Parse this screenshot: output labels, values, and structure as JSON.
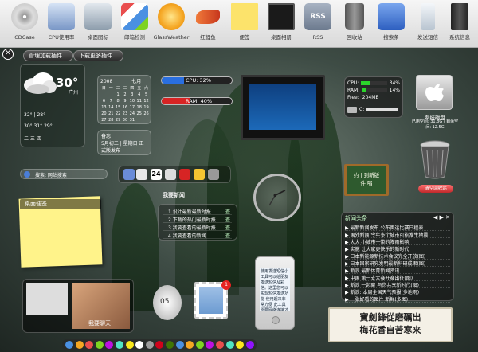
{
  "topbar": {
    "items": [
      {
        "label": "CDCase",
        "icon": "cd-icon",
        "color": "#c9c9c9"
      },
      {
        "label": "CPU使用率",
        "icon": "cpu-icon",
        "color": "#6a8cc8"
      },
      {
        "label": "桌面图标",
        "icon": "desktop-icons-icon",
        "color": "#9aa9b8"
      },
      {
        "label": "邮箱检测",
        "icon": "mail-check-icon",
        "color": "#e8e8e8"
      },
      {
        "label": "GlassWeather",
        "icon": "sun-icon",
        "color": "#f5a623"
      },
      {
        "label": "红鲤鱼",
        "icon": "fish-icon",
        "color": "#d84a2a"
      },
      {
        "label": "便签",
        "icon": "sticky-note-icon",
        "color": "#fce36b"
      },
      {
        "label": "桌面相册",
        "icon": "photo-album-icon",
        "color": "#222222"
      },
      {
        "label": "RSS",
        "icon": "rss-icon",
        "color": "#8a96a8"
      },
      {
        "label": "回收站",
        "icon": "recycle-bin-icon",
        "color": "#707070"
      },
      {
        "label": "搜索条",
        "icon": "search-bar-icon",
        "color": "#4a7ed8"
      },
      {
        "label": "发送短信",
        "icon": "sms-phone-icon",
        "color": "#dde4ec"
      },
      {
        "label": "系统信息",
        "icon": "system-info-icon",
        "color": "#3a3a3a"
      }
    ]
  },
  "toolbar": {
    "close": "✕",
    "manage_label": "管理加载插件...",
    "download_label": "下载更多插件..."
  },
  "weather": {
    "temp": "30°",
    "city": "广州",
    "rows": [
      "32° | 28°",
      "30° 31° 29°",
      "二 三 四"
    ]
  },
  "calendar": {
    "year": "2008",
    "month": "七月",
    "days": [
      "日",
      "一",
      "二",
      "三",
      "四",
      "五",
      "六",
      "",
      "",
      "1",
      "2",
      "3",
      "4",
      "5",
      "6",
      "7",
      "8",
      "9",
      "10",
      "11",
      "12",
      "13",
      "14",
      "15",
      "16",
      "17",
      "18",
      "19",
      "20",
      "21",
      "22",
      "23",
      "24",
      "25",
      "26",
      "27",
      "28",
      "29",
      "30",
      "31",
      "",
      ""
    ],
    "memo_title": "备忘：",
    "memo_text": "5月初二 | 星期日 正式版发布"
  },
  "gauges": {
    "cpu": {
      "text": "CPU: 32%",
      "value": 0.32,
      "color": "#2a6fe0"
    },
    "ram": {
      "text": "RAM: 40%",
      "value": 0.4,
      "color": "#d72424"
    }
  },
  "sysmon": {
    "cpu": "CPU:",
    "cpu_val": "34%",
    "cpu_level": 0.34,
    "ram": "RAM:",
    "ram_val": "14%",
    "ram_level": 0.14,
    "free": "Free:",
    "free_val": "204MB",
    "drive": "C:"
  },
  "sysdisk": {
    "title": "系统磁盘",
    "info": "已用空间: 31.8G / 剩余空间: 12.5G"
  },
  "recycle": {
    "label": "清空回收站"
  },
  "search": {
    "placeholder": "搜索: 网站搜索"
  },
  "favorites": {
    "label": "我要新闻"
  },
  "board": {
    "lines": [
      "约 | 到新版",
      "件 唱"
    ]
  },
  "note": {
    "title": "桌面便签"
  },
  "recent": {
    "items": [
      {
        "title": "1.设计最新最新时报",
        "tag": "查"
      },
      {
        "title": "2.下载的热门最新时报",
        "tag": "查"
      },
      {
        "title": "3.我要查看的最新时报",
        "tag": "查"
      },
      {
        "title": "4.我要查看的新闻",
        "tag": "查"
      }
    ]
  },
  "news": {
    "title": "新闻头条",
    "controls": "◀ ▶ ✕",
    "items": [
      "▶ 最新新闻发布 公布奥运比赛日程表",
      "▶ 国外新闻 今年多个城市可能发生地震",
      "▶ 大大 小城市一带的降雨影响",
      "▶ 实施 让大家更快乐的新时代",
      "▶ 日本新能源新技术会议完全开放(图)",
      "▶ 日本国家研究发明最新科研成果(图)",
      "▶ 新浪 最新体育新闻资讯",
      "▶ 中国 第一支大赛开赛出征(图)",
      "▶ 新浪 一起聊 与您共享新时代(图)",
      "▶ 新浪: 本周全国天气预报(多地雨)",
      "▶ 一张好看的图片 新鲜(多图)"
    ]
  },
  "calligraphy": {
    "line1": "寶劍鋒從磨礪出",
    "line2": "梅花香自苦寒来"
  },
  "phone": {
    "text": "使用发送短信小工具可以给朋友发送短信及彩信。这里您可以实现短信发送功能 使用起来非常方便 此工具需要网络连接才能使用"
  },
  "egg": {
    "value": "05"
  },
  "stamp": {
    "badge": "1"
  },
  "bottom_widget": {
    "title": "我要聊天"
  },
  "dock": {
    "colors": [
      "#4a90e2",
      "#f5a623",
      "#e94e4e",
      "#7ed321",
      "#bd10e0",
      "#50e3c2",
      "#f8e71c",
      "#ffffff",
      "#9b9b9b",
      "#d0021b",
      "#417505",
      "#4a90e2",
      "#f5a623",
      "#7ed321",
      "#bd10e0",
      "#e94e4e",
      "#50e3c2",
      "#f8e71c",
      "#9013fe"
    ]
  }
}
